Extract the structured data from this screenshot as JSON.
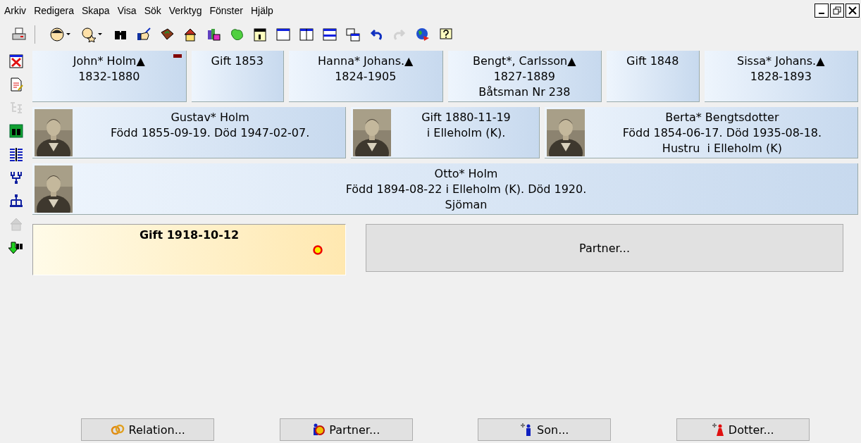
{
  "menu": [
    "Arkiv",
    "Redigera",
    "Skapa",
    "Visa",
    "Sök",
    "Verktyg",
    "Fönster",
    "Hjälp"
  ],
  "toolbar": [
    {
      "kind": "printer",
      "disabled": false
    },
    {
      "kind": "separator"
    },
    {
      "kind": "face",
      "disabled": false
    },
    {
      "kind": "caret",
      "disabled": false
    },
    {
      "kind": "face-star",
      "disabled": false
    },
    {
      "kind": "caret",
      "disabled": false
    },
    {
      "kind": "binoculars",
      "disabled": false
    },
    {
      "kind": "hand",
      "disabled": false
    },
    {
      "kind": "book",
      "disabled": false
    },
    {
      "kind": "house",
      "disabled": false
    },
    {
      "kind": "books",
      "disabled": false
    },
    {
      "kind": "map",
      "disabled": false
    },
    {
      "kind": "calendar",
      "disabled": false
    },
    {
      "kind": "win-single",
      "disabled": false
    },
    {
      "kind": "win-vsplit",
      "disabled": false
    },
    {
      "kind": "win-hsplit",
      "disabled": false
    },
    {
      "kind": "win-cascade",
      "disabled": false
    },
    {
      "kind": "undo",
      "disabled": false
    },
    {
      "kind": "redo",
      "disabled": true
    },
    {
      "kind": "globe",
      "disabled": false
    },
    {
      "kind": "help",
      "disabled": false
    }
  ],
  "sidebar": [
    {
      "kind": "delete-doc",
      "disabled": false
    },
    {
      "kind": "edit-doc",
      "disabled": false
    },
    {
      "kind": "tree",
      "disabled": true
    },
    {
      "kind": "grid-binoculars",
      "disabled": false
    },
    {
      "kind": "columns",
      "disabled": false
    },
    {
      "kind": "pedigree",
      "disabled": false
    },
    {
      "kind": "org",
      "disabled": false
    },
    {
      "kind": "house",
      "disabled": true
    },
    {
      "kind": "download",
      "disabled": false
    }
  ],
  "rows": [
    {
      "cards": [
        {
          "kind": "person",
          "lines": [
            "John* Holm",
            "1832-1880"
          ],
          "mark": "▲",
          "flagged": true
        },
        {
          "kind": "marriage",
          "lines": [
            "Gift 1853"
          ]
        },
        {
          "kind": "person",
          "lines": [
            "Hanna* Johans.",
            "1824-1905"
          ],
          "mark": "▲"
        },
        {
          "kind": "person",
          "lines": [
            "Bengt*, Carlsson",
            "1827-1889",
            "Båtsman Nr 238"
          ],
          "mark": "▲"
        },
        {
          "kind": "marriage",
          "lines": [
            "Gift 1848"
          ]
        },
        {
          "kind": "person",
          "lines": [
            "Sissa* Johans.",
            "1828-1893"
          ],
          "mark": "▲"
        }
      ]
    },
    {
      "cards": [
        {
          "kind": "person",
          "lines": [
            "Gustav* Holm",
            "Född 1855-09-19. Död 1947-02-07."
          ],
          "photo": true
        },
        {
          "kind": "marriage",
          "lines": [
            "Gift 1880-11-19",
            "i Elleholm (K)."
          ],
          "photo": true
        },
        {
          "kind": "person",
          "lines": [
            "Berta* Bengtsdotter",
            "Född 1854-06-17. Död 1935-08-18.",
            "Hustru  i Elleholm (K)"
          ],
          "photo": true
        }
      ]
    },
    {
      "cards": [
        {
          "kind": "person",
          "lines": [
            "Otto* Holm",
            "Född 1894-08-22 i Elleholm (K). Död 1920.",
            "Sjöman"
          ],
          "photo": true
        }
      ]
    }
  ],
  "marriage": {
    "title": "Gift 1918-10-12",
    "ring": true
  },
  "partner_button": "Partner...",
  "buttons": [
    {
      "kind": "rings",
      "label": "Relation..."
    },
    {
      "kind": "couple",
      "label": "Partner..."
    },
    {
      "kind": "son",
      "label": "Son..."
    },
    {
      "kind": "daughter",
      "label": "Dotter..."
    }
  ]
}
